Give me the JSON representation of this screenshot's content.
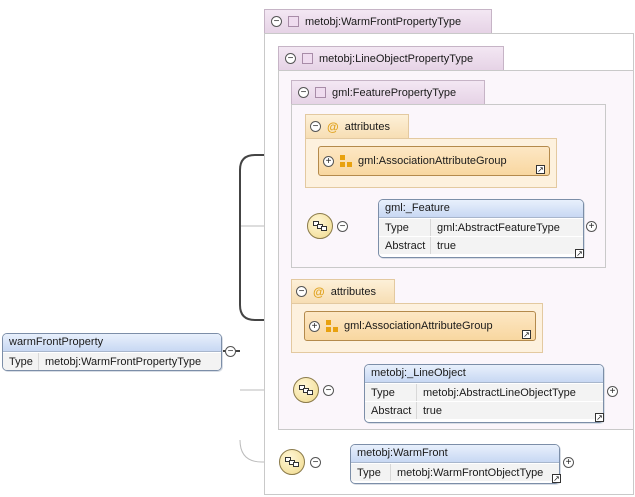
{
  "root_element": {
    "name": "warmFrontProperty",
    "type_label": "Type",
    "type_value": "metobj:WarmFrontPropertyType"
  },
  "types": {
    "warm_front_property_type": "metobj:WarmFrontPropertyType",
    "line_object_property_type": "metobj:LineObjectPropertyType",
    "feature_property_type": "gml:FeaturePropertyType"
  },
  "attributes_label": "attributes",
  "attribute_group": "gml:AssociationAttributeGroup",
  "elements": {
    "feature": {
      "name": "gml:_Feature",
      "rows": [
        {
          "k": "Type",
          "v": "gml:AbstractFeatureType"
        },
        {
          "k": "Abstract",
          "v": "true"
        }
      ]
    },
    "line_object": {
      "name": "metobj:_LineObject",
      "rows": [
        {
          "k": "Type",
          "v": "metobj:AbstractLineObjectType"
        },
        {
          "k": "Abstract",
          "v": "true"
        }
      ]
    },
    "warm_front": {
      "name": "metobj:WarmFront",
      "rows": [
        {
          "k": "Type",
          "v": "metobj:WarmFrontObjectType"
        }
      ]
    }
  },
  "symbols": {
    "collapse": "−",
    "expand": "+",
    "at": "@",
    "link": "↗"
  },
  "colors": {
    "type_tab": "#e6d3e6",
    "attr_bg": "#fdf1de",
    "elem_head": "#c8d8f3"
  }
}
